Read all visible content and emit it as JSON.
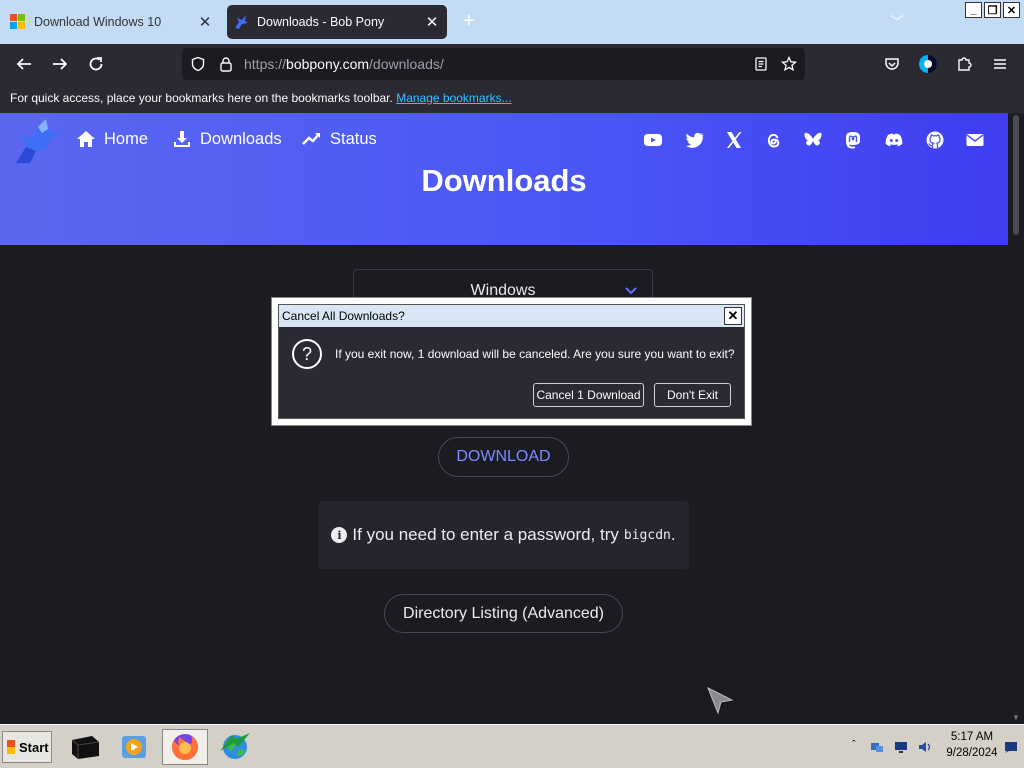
{
  "browser": {
    "tabs": [
      {
        "title": "Download Windows 10",
        "active": false
      },
      {
        "title": "Downloads - Bob Pony",
        "active": true
      }
    ],
    "url": {
      "prefix": "https://",
      "host": "bobpony.com",
      "path": "/downloads/"
    },
    "bookmarks_bar": {
      "text": "For quick access, place your bookmarks here on the bookmarks toolbar.",
      "link": "Manage bookmarks..."
    }
  },
  "site": {
    "nav": [
      {
        "label": "Home",
        "icon": "home-icon"
      },
      {
        "label": "Downloads",
        "icon": "download-icon"
      },
      {
        "label": "Status",
        "icon": "trending-up-icon"
      }
    ],
    "social_icons": [
      "youtube-icon",
      "twitter-icon",
      "x-icon",
      "threads-icon",
      "bluesky-icon",
      "mastodon-icon",
      "discord-icon",
      "github-icon",
      "mail-icon"
    ],
    "title": "Downloads",
    "os_select": "Windows",
    "download_button": "DOWNLOAD",
    "hint_text": "If you need to enter a password, try",
    "hint_code": "bigcdn",
    "hint_end": ".",
    "dir_button": "Directory Listing (Advanced)"
  },
  "dialog": {
    "title": "Cancel All Downloads?",
    "message": "If you exit now, 1 download will be canceled. Are you sure you want to exit?",
    "confirm": "Cancel 1 Download",
    "cancel": "Don't Exit"
  },
  "taskbar": {
    "start": "Start",
    "time": "5:17 AM",
    "date": "9/28/2024"
  },
  "colors": {
    "hero_start": "#5a67f0",
    "hero_end": "#3f3cf2",
    "page_bg": "#1b1b22",
    "link": "#33c3ff"
  }
}
